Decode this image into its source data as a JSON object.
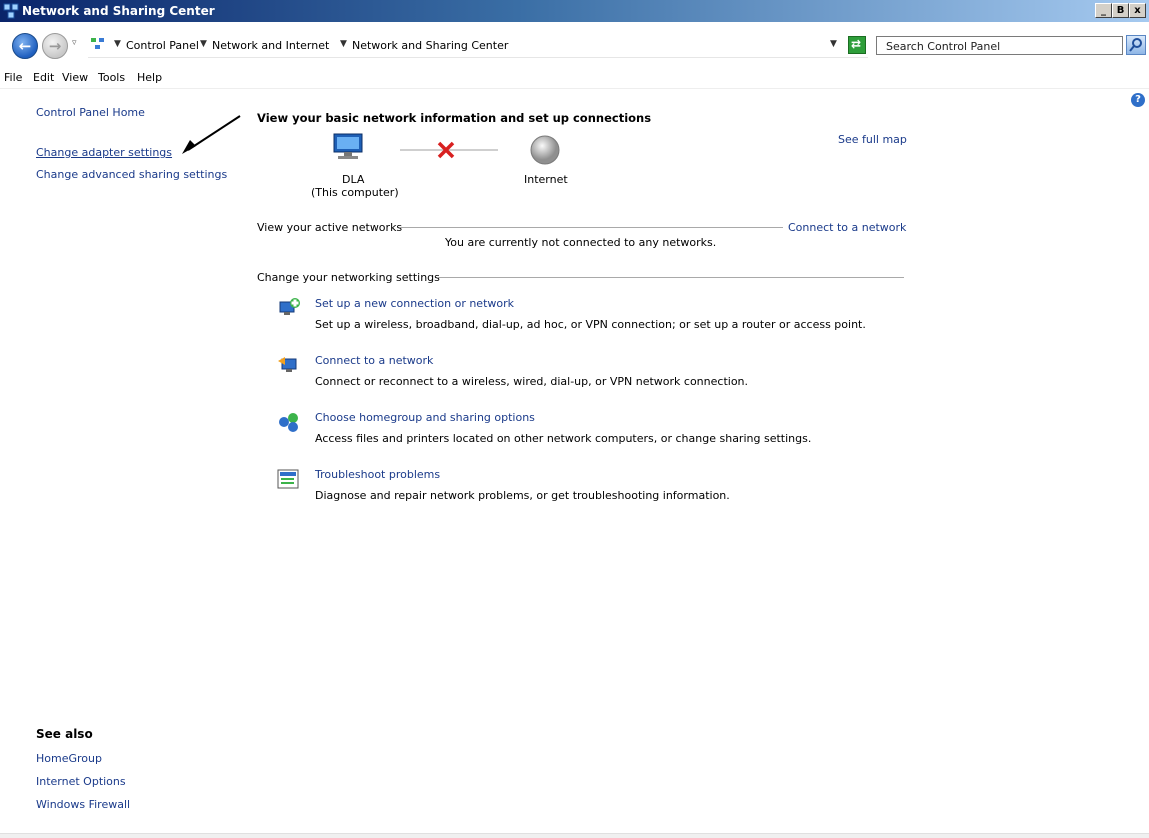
{
  "window": {
    "title": "Network and Sharing Center",
    "controls": {
      "minimize": "_",
      "restore": "B",
      "close": "x"
    }
  },
  "address_bar": {
    "breadcrumb": [
      "Control Panel",
      "Network and Internet",
      "Network and Sharing Center"
    ],
    "search_placeholder": "Search Control Panel"
  },
  "menubar": {
    "items": [
      "File",
      "Edit",
      "View",
      "Tools",
      "Help"
    ]
  },
  "left_nav": {
    "home": "Control Panel Home",
    "links": [
      "Change adapter settings",
      "Change advanced sharing settings"
    ]
  },
  "see_also": {
    "heading": "See also",
    "links": [
      "HomeGroup",
      "Internet Options",
      "Windows Firewall"
    ]
  },
  "main": {
    "heading": "View your basic network information and set up connections",
    "see_full_map": "See full map",
    "map": {
      "computer_name": "DLA",
      "computer_sub": "(This computer)",
      "internet_label": "Internet"
    },
    "active_networks": {
      "label": "View your active networks",
      "connect_link": "Connect to a network",
      "status": "You are currently not connected to any networks."
    },
    "settings_label": "Change your networking settings",
    "tasks": [
      {
        "title": "Set up a new connection or network",
        "description": "Set up a wireless, broadband, dial-up, ad hoc, or VPN connection; or set up a router or access point.",
        "icon": "new-connection-icon"
      },
      {
        "title": "Connect to a network",
        "description": "Connect or reconnect to a wireless, wired, dial-up, or VPN network connection.",
        "icon": "connect-network-icon"
      },
      {
        "title": "Choose homegroup and sharing options",
        "description": "Access files and printers located on other network computers, or change sharing settings.",
        "icon": "homegroup-icon"
      },
      {
        "title": "Troubleshoot problems",
        "description": "Diagnose and repair network problems, or get troubleshooting information.",
        "icon": "troubleshoot-icon"
      }
    ]
  }
}
